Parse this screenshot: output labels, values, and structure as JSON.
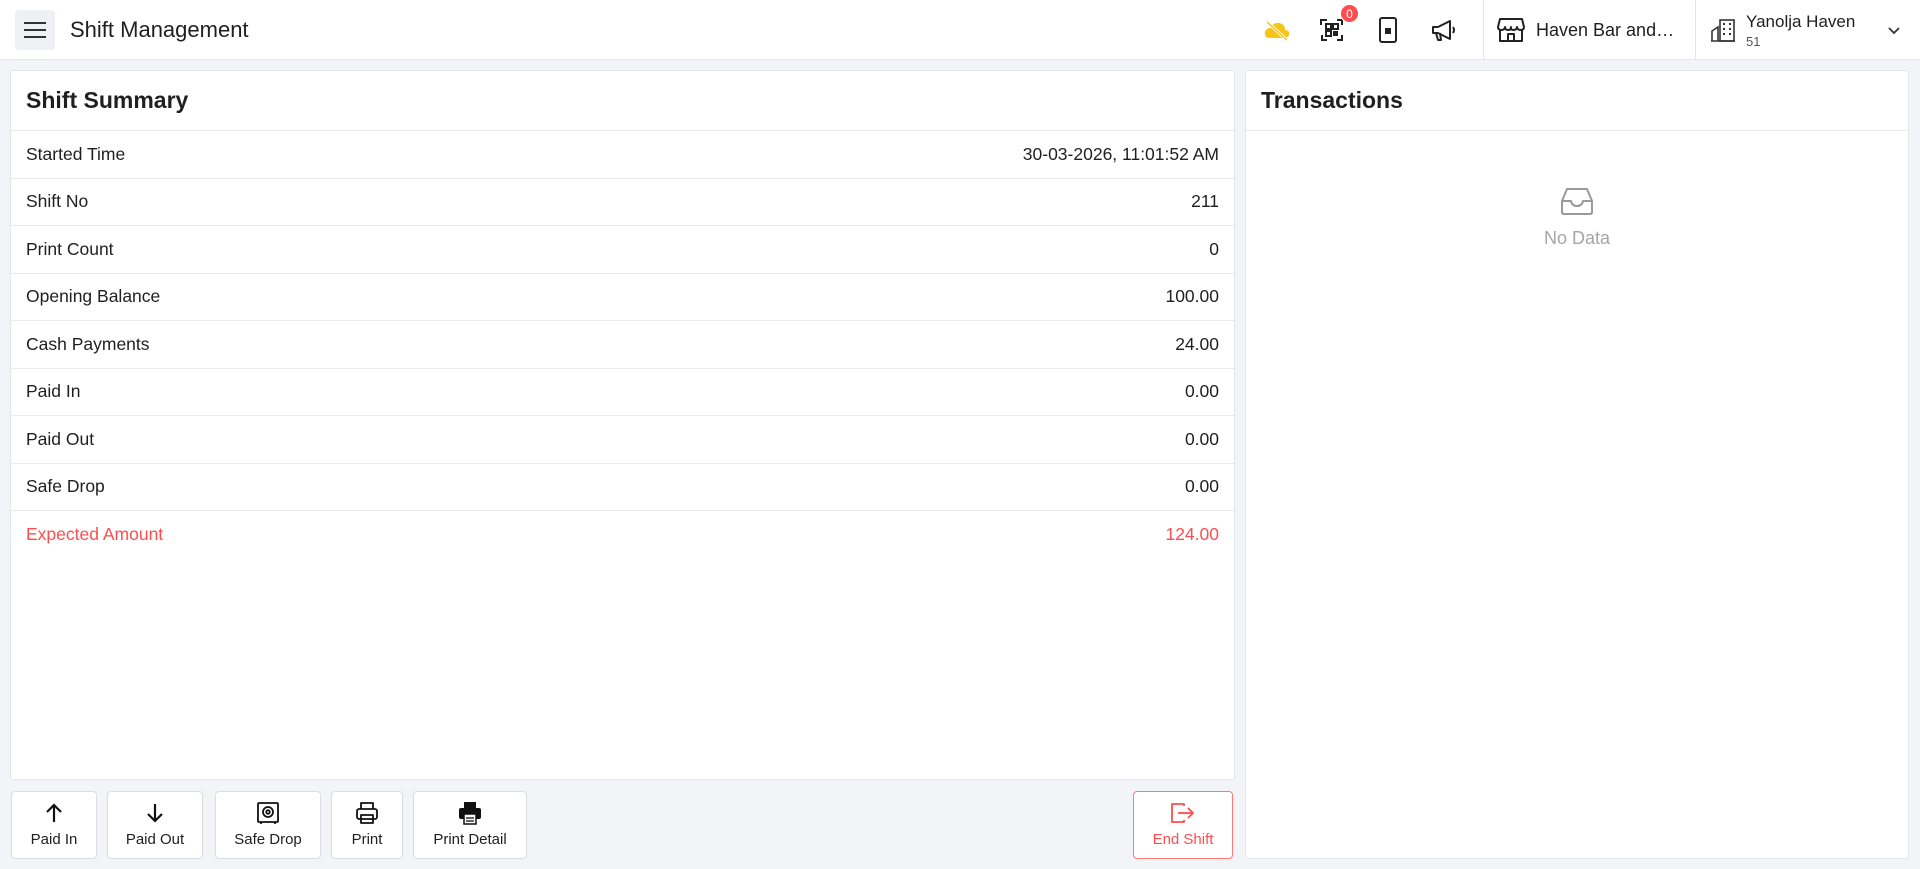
{
  "header": {
    "title": "Shift Management",
    "notification_count": "0",
    "store_name": "Haven Bar and R...",
    "user_name": "Yanolja Haven",
    "user_number": "51",
    "icons": [
      "menu-icon",
      "cloud-off-icon",
      "qr-code-icon",
      "tablet-icon",
      "megaphone-icon",
      "store-icon",
      "building-icon",
      "chevron-down-icon"
    ]
  },
  "summary": {
    "title": "Shift Summary",
    "rows": [
      {
        "label": "Started Time",
        "value": "30-03-2026, 11:01:52 AM"
      },
      {
        "label": "Shift No",
        "value": "211"
      },
      {
        "label": "Print Count",
        "value": "0"
      },
      {
        "label": "Opening Balance",
        "value": "100.00"
      },
      {
        "label": "Cash Payments",
        "value": "24.00"
      },
      {
        "label": "Paid In",
        "value": "0.00"
      },
      {
        "label": "Paid Out",
        "value": "0.00"
      },
      {
        "label": "Safe Drop",
        "value": "0.00"
      },
      {
        "label": "Expected Amount",
        "value": "124.00"
      }
    ]
  },
  "transactions": {
    "title": "Transactions",
    "empty_text": "No Data"
  },
  "actions": {
    "paid_in": "Paid In",
    "paid_out": "Paid Out",
    "safe_drop": "Safe Drop",
    "print": "Print",
    "print_detail": "Print Detail",
    "end_shift": "End Shift"
  },
  "colors": {
    "accent_warning": "#fadb14",
    "danger": "#ff4d4f",
    "muted": "#a6a6a6"
  }
}
